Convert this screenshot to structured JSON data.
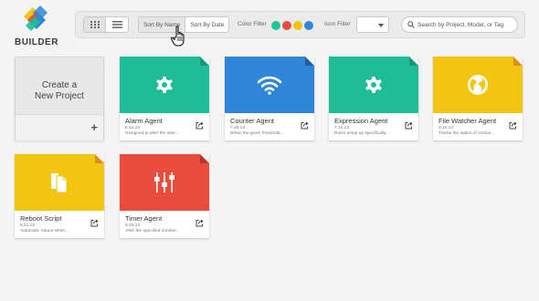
{
  "app": {
    "name": "BUILDER"
  },
  "toolbar": {
    "sort_by_name": "Sort By Name",
    "sort_by_date": "Sort By Date",
    "color_filter_label": "Color Filter",
    "color_filter_colors": [
      "#1ec49a",
      "#e74c3c",
      "#f1c40f",
      "#2e86de"
    ],
    "icon_filter_label": "Icon Filter",
    "icon_filter_value": "",
    "search_placeholder": "Search by Project, Model, or Tag",
    "search_value": ""
  },
  "create_card": {
    "line1": "Create a",
    "line2": "New Project"
  },
  "projects": [
    {
      "name": "Alarm Agent",
      "date": "6.12.13",
      "description": "Designed to alert the user...",
      "color": "#1fbd97",
      "fold_color": "#17967a",
      "icon": "gear-icon"
    },
    {
      "name": "Counter Agent",
      "date": "7.26.13",
      "description": "When the given threshold...",
      "color": "#2f86d8",
      "fold_color": "#1e5f9e",
      "icon": "wifi-icon"
    },
    {
      "name": "Expression Agent",
      "date": "7.12.13",
      "description": "Rules setup up specifically...",
      "color": "#1fbd97",
      "fold_color": "#17967a",
      "icon": "gear-icon"
    },
    {
      "name": "File Watcher Agent",
      "date": "6.10.13",
      "description": "Tracks the status of certain...",
      "color": "#f2c512",
      "fold_color": "#e08a1a",
      "icon": "globe-icon"
    },
    {
      "name": "Reboot Script",
      "date": "6.21.13",
      "description": "Automatic reboot when...",
      "color": "#f2c512",
      "fold_color": "#e08a1a",
      "icon": "documents-icon"
    },
    {
      "name": "Timer Agent",
      "date": "9.03.13",
      "description": "After the specified number...",
      "color": "#e84c3d",
      "fold_color": "#b83428",
      "icon": "sliders-icon"
    }
  ]
}
